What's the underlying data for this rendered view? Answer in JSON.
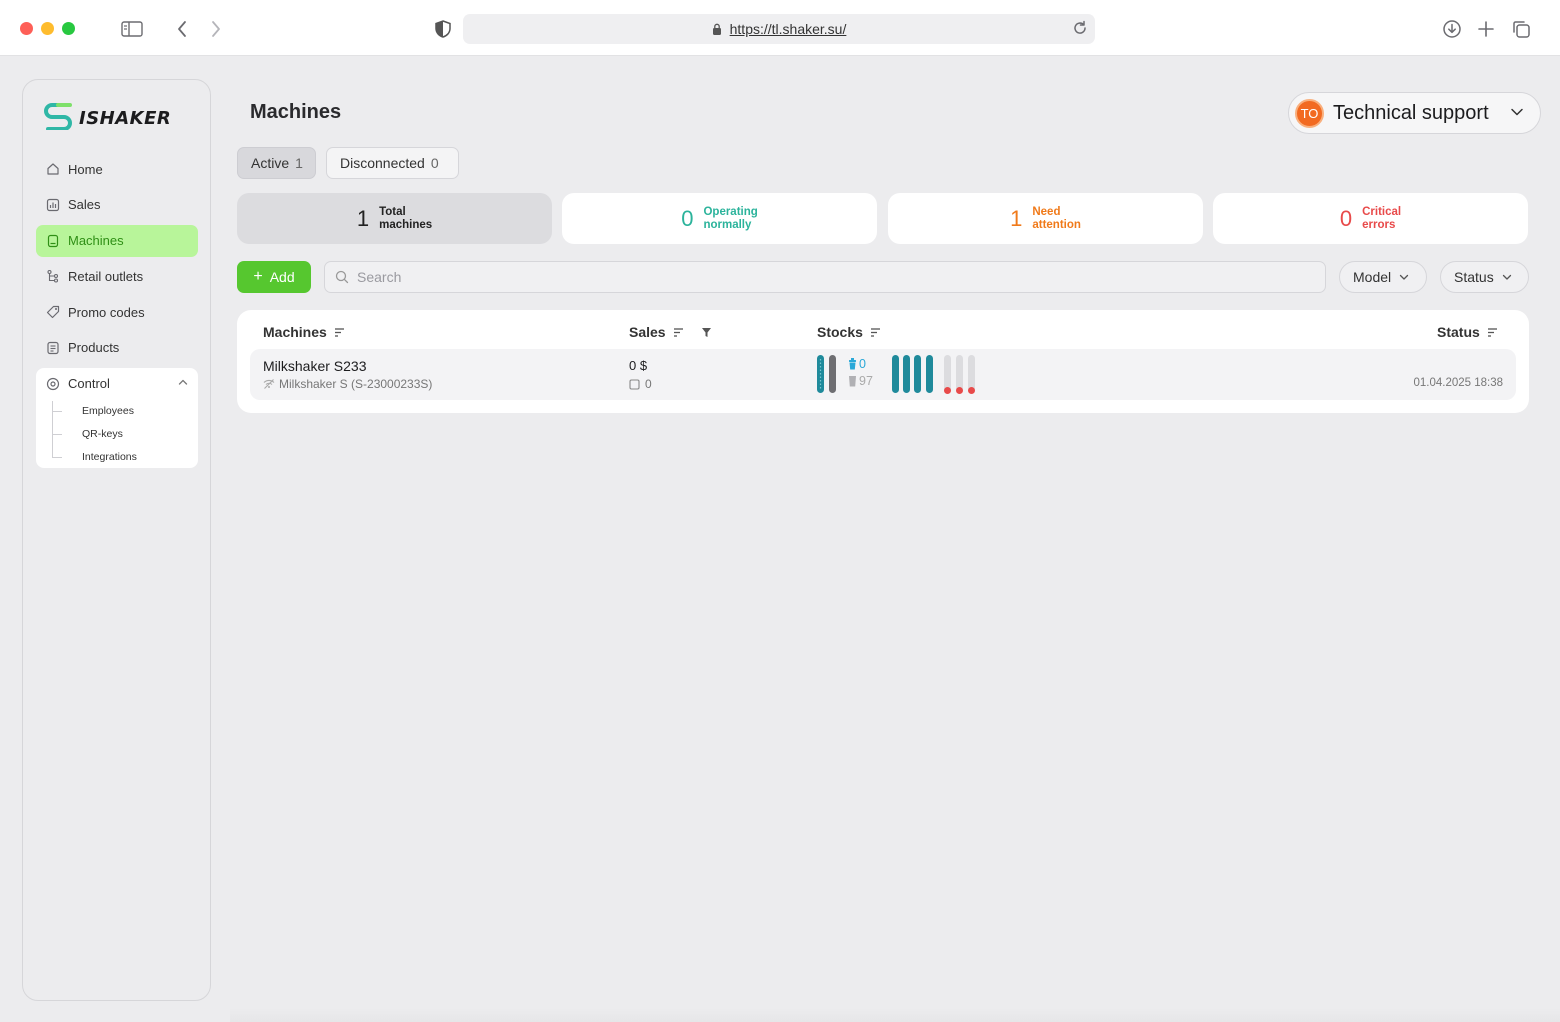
{
  "browser": {
    "url": "https://tl.shaker.su/"
  },
  "sidebar": {
    "logo_text": "ISHAKER",
    "items": [
      {
        "label": "Home",
        "icon": "home-icon"
      },
      {
        "label": "Sales",
        "icon": "chart-icon"
      },
      {
        "label": "Machines",
        "icon": "machine-icon",
        "active": true
      },
      {
        "label": "Retail outlets",
        "icon": "outlets-icon"
      },
      {
        "label": "Promo codes",
        "icon": "tag-icon"
      },
      {
        "label": "Products",
        "icon": "list-icon"
      }
    ],
    "control": {
      "label": "Control",
      "icon": "gear-icon",
      "expanded": true,
      "children": [
        "Employees",
        "QR-keys",
        "Integrations"
      ]
    }
  },
  "header": {
    "title": "Machines",
    "user": {
      "initials": "TO",
      "name": "Technical support"
    }
  },
  "tabs": [
    {
      "label": "Active",
      "count": "1",
      "selected": true
    },
    {
      "label": "Disconnected",
      "count": "0",
      "selected": false
    }
  ],
  "summary": [
    {
      "value": "1",
      "line1": "Total",
      "line2": "machines",
      "color": "#222222"
    },
    {
      "value": "0",
      "line1": "Operating",
      "line2": "normally",
      "color": "#2bb39b"
    },
    {
      "value": "1",
      "line1": "Need",
      "line2": "attention",
      "color": "#f07a1a"
    },
    {
      "value": "0",
      "line1": "Critical",
      "line2": "errors",
      "color": "#e84a4a"
    }
  ],
  "toolbar": {
    "add_label": "Add",
    "search_placeholder": "Search",
    "filters": [
      "Model",
      "Status"
    ]
  },
  "table": {
    "columns": [
      "Machines",
      "Sales",
      "Stocks",
      "Status"
    ],
    "rows": [
      {
        "name": "Milkshaker S233",
        "model": "Milkshaker S (S-23000233S)",
        "sales_amount": "0 $",
        "sales_count": "0",
        "cups_top": "0",
        "cups_bottom": "97",
        "status_date": "01.04.2025 18:38"
      }
    ]
  },
  "colors": {
    "accent_green": "#56c72f",
    "active_nav_bg": "#b8f59a",
    "stock_teal": "#1f8a9b",
    "stock_gray": "#6e6e72",
    "stock_empty": "#d6d6da",
    "stock_alert": "#e84a4a"
  }
}
